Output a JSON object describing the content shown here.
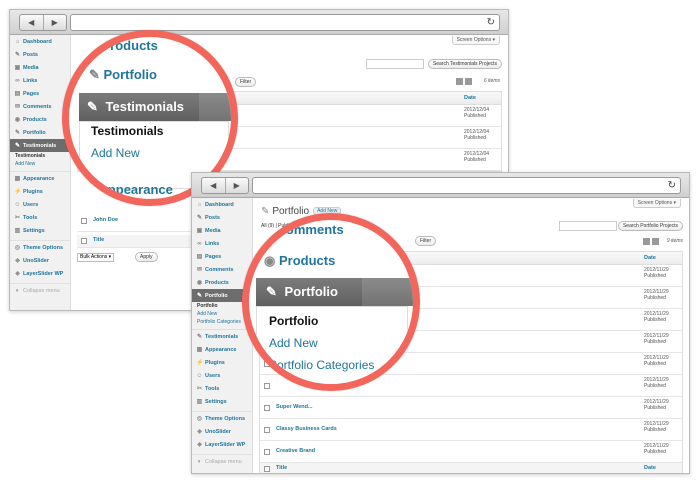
{
  "colors": {
    "ring": "#f2665c",
    "link": "#21759b",
    "active_menu": "#6d6d6d"
  },
  "back_window": {
    "menu": [
      {
        "icon": "house-icon",
        "glyph": "⌂",
        "label": "Dashboard"
      },
      {
        "icon": "pin-icon",
        "glyph": "✎",
        "label": "Posts"
      },
      {
        "icon": "media-icon",
        "glyph": "▣",
        "label": "Media"
      },
      {
        "icon": "link-icon",
        "glyph": "∞",
        "label": "Links"
      },
      {
        "icon": "page-icon",
        "glyph": "▤",
        "label": "Pages"
      },
      {
        "icon": "comment-icon",
        "glyph": "✉",
        "label": "Comments"
      },
      {
        "icon": "products-icon",
        "glyph": "◉",
        "label": "Products"
      },
      {
        "icon": "pin-icon",
        "glyph": "✎",
        "label": "Portfolio"
      },
      {
        "icon": "pin-icon",
        "glyph": "✎",
        "label": "Testimonials",
        "active": true
      }
    ],
    "submenu": [
      {
        "label": "Testimonials",
        "current": true
      },
      {
        "label": "Add New"
      }
    ],
    "menu2": [
      {
        "icon": "appearance-icon",
        "glyph": "▦",
        "label": "Appearance"
      },
      {
        "icon": "plugin-icon",
        "glyph": "⚡",
        "label": "Plugins"
      },
      {
        "icon": "users-icon",
        "glyph": "☺",
        "label": "Users"
      },
      {
        "icon": "tools-icon",
        "glyph": "✂",
        "label": "Tools"
      },
      {
        "icon": "settings-icon",
        "glyph": "▥",
        "label": "Settings"
      }
    ],
    "menu3": [
      {
        "icon": "theme-icon",
        "glyph": "◎",
        "label": "Theme Options"
      },
      {
        "icon": "uno-icon",
        "glyph": "◈",
        "label": "UnoSlider"
      },
      {
        "icon": "layer-icon",
        "glyph": "◈",
        "label": "LayerSlider WP"
      }
    ],
    "collapse": "Collapse menu",
    "screen_options": "Screen Options ▾",
    "search_button": "Search Testimonials Projects",
    "filter_button": "Filter",
    "items_count": "6 items",
    "date_header": "Date",
    "rows": [
      {
        "date": "2012/12/04",
        "status": "Published"
      },
      {
        "date": "2012/12/04",
        "status": "Published"
      },
      {
        "date": "2012/12/04",
        "status": "Published"
      }
    ],
    "row_author": "John Doe",
    "title_header": "Title",
    "bulk_actions": "Bulk Actions",
    "apply_button": "Apply",
    "zoom": {
      "products": "Products",
      "portfolio": "Portfolio",
      "testimonials": "Testimonials",
      "sub_testimonials": "Testimonials",
      "sub_add_new": "Add New",
      "appearance": "Appearance"
    }
  },
  "front_window": {
    "page_title": "Portfolio",
    "add_new": "Add New",
    "view_links": "All (9) | Published",
    "menu": [
      {
        "icon": "house-icon",
        "glyph": "⌂",
        "label": "Dashboard"
      },
      {
        "icon": "pin-icon",
        "glyph": "✎",
        "label": "Posts"
      },
      {
        "icon": "media-icon",
        "glyph": "▣",
        "label": "Media"
      },
      {
        "icon": "link-icon",
        "glyph": "∞",
        "label": "Links"
      },
      {
        "icon": "page-icon",
        "glyph": "▤",
        "label": "Pages"
      },
      {
        "icon": "comment-icon",
        "glyph": "✉",
        "label": "Comments"
      },
      {
        "icon": "products-icon",
        "glyph": "◉",
        "label": "Products"
      },
      {
        "icon": "pin-icon",
        "glyph": "✎",
        "label": "Portfolio",
        "active": true
      }
    ],
    "submenu": [
      {
        "label": "Portfolio",
        "current": true
      },
      {
        "label": "Add New"
      },
      {
        "label": "Portfolio Categories"
      }
    ],
    "menu2": [
      {
        "icon": "pin-icon",
        "glyph": "✎",
        "label": "Testimonials"
      },
      {
        "icon": "appearance-icon",
        "glyph": "▦",
        "label": "Appearance"
      },
      {
        "icon": "plugin-icon",
        "glyph": "⚡",
        "label": "Plugins"
      },
      {
        "icon": "users-icon",
        "glyph": "☺",
        "label": "Users"
      },
      {
        "icon": "tools-icon",
        "glyph": "✂",
        "label": "Tools"
      },
      {
        "icon": "settings-icon",
        "glyph": "▥",
        "label": "Settings"
      }
    ],
    "menu3": [
      {
        "icon": "theme-icon",
        "glyph": "◎",
        "label": "Theme Options"
      },
      {
        "icon": "uno-icon",
        "glyph": "◈",
        "label": "UnoSlider"
      },
      {
        "icon": "layer-icon",
        "glyph": "◈",
        "label": "LayerSlider WP"
      }
    ],
    "collapse": "Collapse menu",
    "screen_options": "Screen Options ▾",
    "search_button": "Search Portfolio Projects",
    "filter_button": "Filter",
    "items_count": "9 items",
    "date_header": "Date",
    "rows": [
      {
        "title": "",
        "date": "2012/11/29",
        "status": "Published"
      },
      {
        "title": "",
        "date": "2012/11/29",
        "status": "Published"
      },
      {
        "title": "",
        "date": "2012/11/29",
        "status": "Published"
      },
      {
        "title": "",
        "date": "2012/11/29",
        "status": "Published"
      },
      {
        "title": "",
        "date": "2012/11/29",
        "status": "Published"
      },
      {
        "title": "",
        "date": "2012/11/29",
        "status": "Published"
      },
      {
        "title": "Super Wend...",
        "date": "2012/11/29",
        "status": "Published"
      },
      {
        "title": "Classy Business Cards",
        "date": "2012/11/29",
        "status": "Published"
      },
      {
        "title": "Creative Brand",
        "date": "2012/11/29",
        "status": "Published"
      }
    ],
    "title_header": "Title",
    "zoom": {
      "comments": "Comments",
      "products": "Products",
      "portfolio": "Portfolio",
      "sub_portfolio": "Portfolio",
      "sub_add_new": "Add New",
      "sub_categories": "Portfolio Categories"
    }
  }
}
